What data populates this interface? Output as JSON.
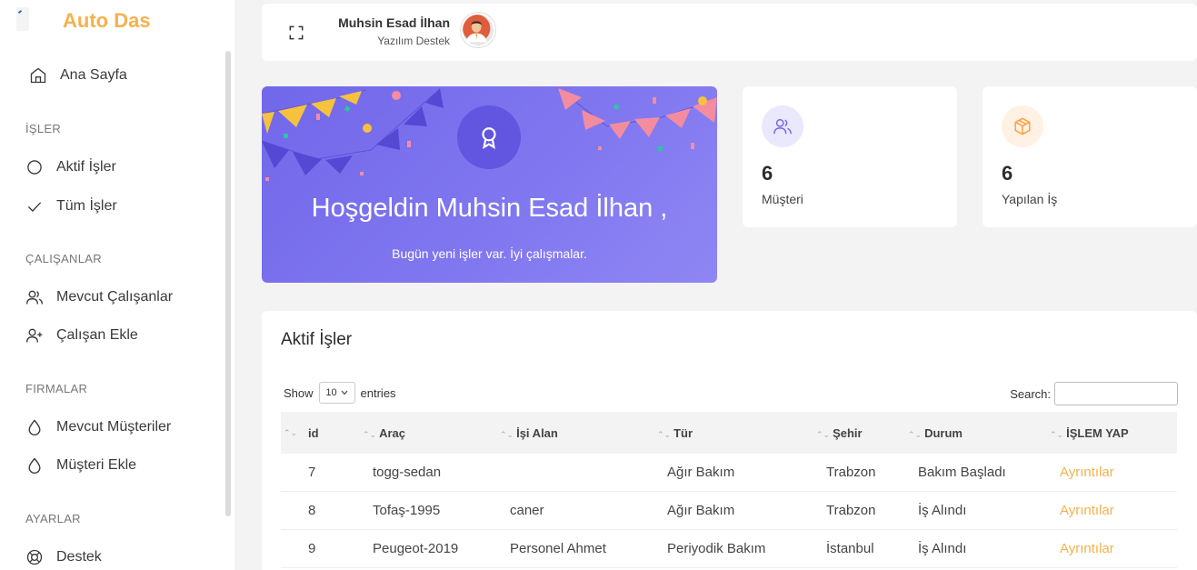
{
  "sidebar": {
    "logo_text": "Auto Das",
    "home_label": "Ana Sayfa",
    "sections": {
      "isler": "İŞLER",
      "calisanlar": "ÇALIŞANLAR",
      "firmalar": "FIRMALAR",
      "ayarlar": "AYARLAR"
    },
    "items": {
      "aktif_isler": "Aktif İşler",
      "tum_isler": "Tüm İşler",
      "mevcut_calisanlar": "Mevcut Çalışanlar",
      "calisan_ekle": "Çalışan Ekle",
      "mevcut_musteriler": "Mevcut Müşteriler",
      "musteri_ekle": "Müşteri Ekle",
      "destek": "Destek"
    }
  },
  "header": {
    "user_name": "Muhsin Esad İlhan",
    "user_role": "Yazılım Destek"
  },
  "welcome": {
    "title": "Hoşgeldin Muhsin Esad İlhan ,",
    "subtitle": "Bugün yeni işler var. İyi çalışmalar."
  },
  "stats": [
    {
      "value": "6",
      "label": "Müşteri",
      "icon": "users-icon",
      "color": "#7367f0"
    },
    {
      "value": "6",
      "label": "Yapılan İş",
      "icon": "box-icon",
      "color": "#ff9f43"
    }
  ],
  "table": {
    "title": "Aktif İşler",
    "show_label": "Show",
    "entries_value": "10",
    "entries_label": "entries",
    "search_label": "Search:",
    "columns": [
      "id",
      "Araç",
      "İşi Alan",
      "Tür",
      "Şehir",
      "Durum",
      "İŞLEM YAP"
    ],
    "rows": [
      {
        "id": "7",
        "arac": "togg-sedan",
        "isi_alan": "",
        "tur": "Ağır Bakım",
        "sehir": "Trabzon",
        "durum": "Bakım Başladı",
        "islem": "Ayrıntılar"
      },
      {
        "id": "8",
        "arac": "Tofaş-1995",
        "isi_alan": "caner",
        "tur": "Ağır Bakım",
        "sehir": "Trabzon",
        "durum": "İş Alındı",
        "islem": "Ayrıntılar"
      },
      {
        "id": "9",
        "arac": "Peugeot-2019",
        "isi_alan": "Personel Ahmet",
        "tur": "Periyodik Bakım",
        "sehir": "İstanbul",
        "durum": "İş Alındı",
        "islem": "Ayrıntılar"
      }
    ]
  },
  "colors": {
    "accent": "#f5b14c",
    "primary": "#7367f0",
    "warning": "#ff9f43"
  }
}
